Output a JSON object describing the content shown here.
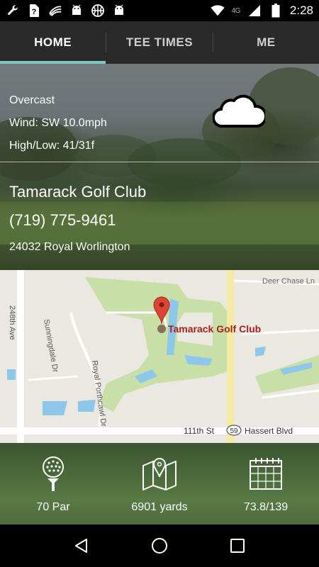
{
  "status_bar": {
    "time": "2:28",
    "network": "4G",
    "icons": [
      "wrench-icon",
      "sim-unknown-icon",
      "sprint-icon",
      "android-icon",
      "basketball-icon",
      "android-icon",
      "wifi-icon",
      "signal-icon",
      "battery-icon"
    ]
  },
  "tabs": [
    {
      "label": "HOME",
      "active": true
    },
    {
      "label": "TEE TIMES",
      "active": false
    },
    {
      "label": "ME",
      "active": false
    }
  ],
  "weather": {
    "condition": "Overcast",
    "wind": "Wind: SW 10.0mph",
    "high_low": "High/Low: 41/31f",
    "icon": "cloud-icon"
  },
  "club": {
    "name": "Tamarack Golf Club",
    "phone": "(719) 775-9461",
    "address": "24032 Royal Worlington"
  },
  "map": {
    "marker_label": "Tamarack Golf Club",
    "streets": {
      "deer_chase": "Deer Chase Ln",
      "ave_248": "248th Ave",
      "sunningdale": "Sunningdale Dr",
      "royal_porthcawl": "Royal Porthcawl Dr",
      "st_111": "111th St",
      "route": "59",
      "hassert": "Hassert Blvd"
    }
  },
  "stats": [
    {
      "icon": "golf-ball-icon",
      "label": "70 Par"
    },
    {
      "icon": "map-pin-icon",
      "label": "6901 yards"
    },
    {
      "icon": "calendar-icon",
      "label": "73.8/139"
    }
  ],
  "colors": {
    "tab_indicator": "#7fc7c0",
    "tab_bar": "#2a2a2a",
    "map_park": "#c8dfa7",
    "map_water": "#8fc7ea",
    "map_road_major": "#f5e9a3",
    "marker": "#db4437",
    "marker_label": "#a51f1f"
  }
}
